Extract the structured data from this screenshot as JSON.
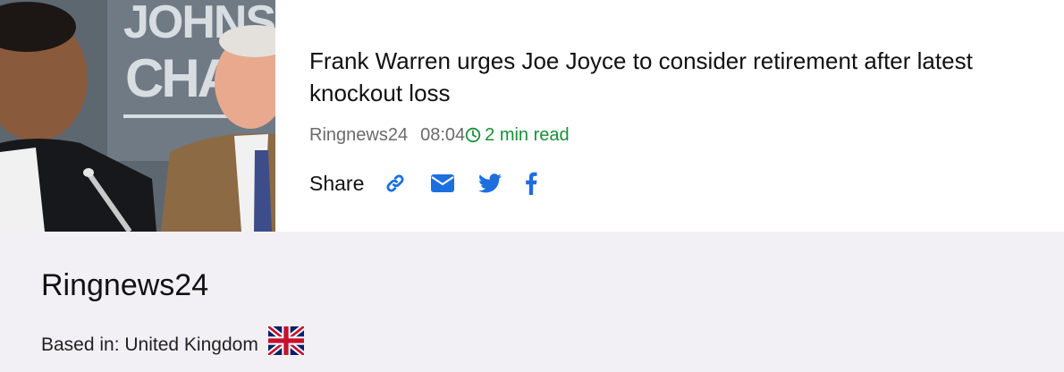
{
  "article": {
    "title": "Frank Warren urges Joe Joyce to consider retirement after latest knockout loss",
    "source": "Ringnews24",
    "time": "08:04",
    "read_time": "2 min read",
    "image_backdrop_text": [
      "JOHNSON",
      "CHAM"
    ]
  },
  "share": {
    "label": "Share",
    "icons": [
      "link-icon",
      "email-icon",
      "twitter-icon",
      "facebook-icon"
    ],
    "icon_color": "#1d6fe0"
  },
  "source_info": {
    "name": "Ringnews24",
    "based_in": "Based in: United Kingdom",
    "flag": "united-kingdom-flag-icon"
  },
  "colors": {
    "read_time": "#1a8f3a",
    "panel_bg": "#f2f0f4",
    "meta_text": "#6b6b6b"
  }
}
